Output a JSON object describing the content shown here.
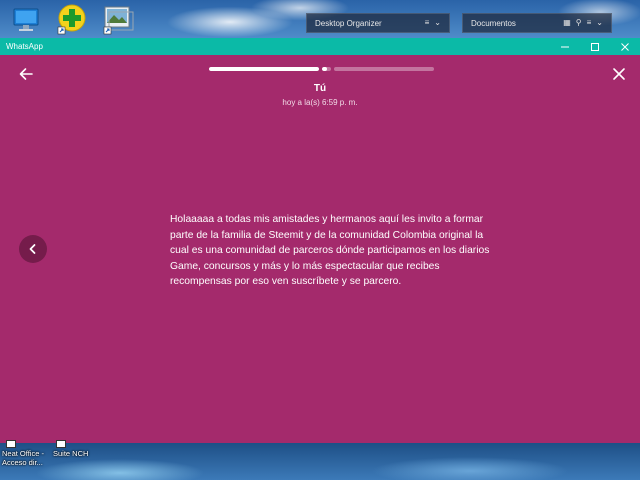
{
  "desktop": {
    "widgets": [
      {
        "label": "Desktop Organizer"
      },
      {
        "label": "Documentos"
      }
    ],
    "bottom_icons": [
      {
        "label": "Neat Office - Acceso dir..."
      },
      {
        "label": "Suite NCH"
      }
    ]
  },
  "window": {
    "title": "WhatsApp"
  },
  "status": {
    "sender": "Tú",
    "timestamp": "hoy a la(s) 6:59 p. m.",
    "message": "Holaaaaa a todas mis amistades y hermanos aquí les invito a formar parte de la familia de Steemit y de la comunidad Colombia original la cual es una comunidad de parceros dónde participamos en los diarios Game, concursos y más y lo más espectacular que recibes recompensas por eso ven suscríbete y se parcero.",
    "background_color": "#a42a6c",
    "progress": [
      {
        "fill": 1.0
      },
      {
        "fill": 0.5
      },
      {
        "fill": 0.0
      }
    ]
  },
  "colors": {
    "titlebar": "#0bbaa7"
  }
}
